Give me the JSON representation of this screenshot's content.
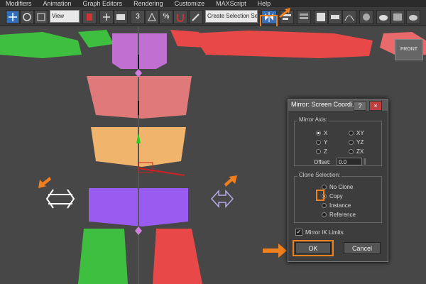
{
  "menu": [
    "Modifiers",
    "Animation",
    "Graph Editors",
    "Rendering",
    "Customize",
    "MAXScript",
    "Help"
  ],
  "toolbar": {
    "view_select": "View",
    "selection_set": "Create Selection Se",
    "snap_label": "3",
    "angle_label": "%"
  },
  "viewport": {
    "label": "FRONT"
  },
  "dialog": {
    "title": "Mirror: Screen Coordi...",
    "help_btn": "?",
    "close_btn": "×",
    "mirror_axis": {
      "label": "Mirror Axis:",
      "options": [
        "X",
        "Y",
        "Z",
        "XY",
        "YZ",
        "ZX"
      ],
      "selected": "X"
    },
    "offset": {
      "label": "Offset:",
      "value": "0.0"
    },
    "clone": {
      "label": "Clone Selection:",
      "options": [
        "No Clone",
        "Copy",
        "Instance",
        "Reference"
      ],
      "selected": "Copy"
    },
    "ik": {
      "label": "Mirror IK Limits",
      "checked": true
    },
    "ok": "OK",
    "cancel": "Cancel"
  },
  "colors": {
    "highlight": "#f07f1d",
    "green": "#3fbf3f",
    "red": "#e84848",
    "purple": "#9a5cf0",
    "pink": "#e07a7a",
    "orange_part": "#f0b46c",
    "magenta": "#c070d0"
  }
}
